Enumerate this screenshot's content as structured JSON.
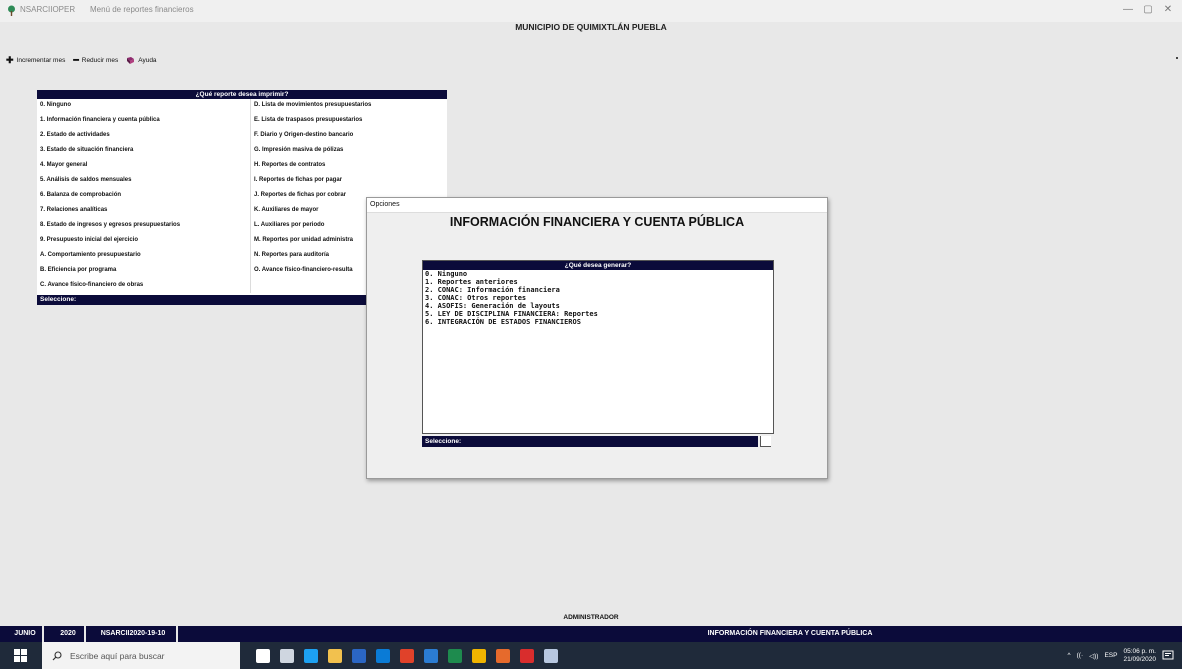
{
  "titlebar": {
    "app_name": "NSARCIIOPER",
    "window_title": "Menú de reportes financieros",
    "minimize_icon": "minimize-icon",
    "maximize_icon": "maximize-icon",
    "close_icon": "close-icon"
  },
  "municipio": "MUNICIPIO DE QUIMIXTLÁN PUEBLA",
  "toolbar": {
    "increment_label": "Incrementar mes",
    "reduce_label": "Reducir mes",
    "help_label": "Ayuda"
  },
  "report_menu": {
    "header": "¿Qué reporte desea imprimir?",
    "left_items": [
      "0. Ninguno",
      "1. Información financiera y cuenta pública",
      "2. Estado de actividades",
      "3. Estado de situación financiera",
      "4. Mayor general",
      "5. Análisis de saldos mensuales",
      "6. Balanza de comprobación",
      "7. Relaciones analíticas",
      "8. Estado de ingresos y egresos presupuestarios",
      "9. Presupuesto inicial del ejercicio",
      "A. Comportamiento presupuestario",
      "B. Eficiencia por programa",
      "C. Avance físico-financiero de obras"
    ],
    "right_items": [
      "D. Lista de movimientos presupuestarios",
      "E. Lista de traspasos presupuestarios",
      "F. Diario y Origen-destino bancario",
      "G. Impresión masiva de pólizas",
      "H. Reportes de contratos",
      "I. Reportes de fichas por pagar",
      "J. Reportes de fichas por cobrar",
      "K. Auxiliares de mayor",
      "L. Auxiliares por periodo",
      "M. Reportes por unidad administra",
      "N. Reportes para auditoría",
      "O. Avance físico-financiero-resulta"
    ],
    "footer": "Seleccione:"
  },
  "dialog": {
    "title": "Opciones",
    "heading": "INFORMACIÓN FINANCIERA Y CUENTA PÚBLICA",
    "box_header": "¿Qué desea generar?",
    "items": [
      "0. Ninguno",
      "1. Reportes anteriores",
      "2. CONAC: Información financiera",
      "3. CONAC: Otros reportes",
      "4. ASOFIS: Generación de layouts",
      "5. LEY DE DISCIPLINA FINANCIERA: Reportes",
      "6. INTEGRACIÓN DE ESTADOS FINANCIEROS"
    ],
    "footer": "Seleccione:",
    "input_value": ""
  },
  "status": {
    "user": "ADMINISTRADOR",
    "month": "JUNIO",
    "year": "2020",
    "system": "NSARCII2020-19-10",
    "current_module": "INFORMACIÓN FINANCIERA Y CUENTA PÚBLICA"
  },
  "taskbar": {
    "search_placeholder": "Escribe aquí para buscar",
    "language": "ESP",
    "time": "05:06 p. m.",
    "date": "21/09/2020",
    "app_colors": [
      "#ffffff",
      "#cfd6e0",
      "#1da1f2",
      "#f2c14e",
      "#2b66c4",
      "#0a7bd6",
      "#e0422a",
      "#2b7cd3",
      "#1e8b4e",
      "#f0b400",
      "#e66a2c",
      "#d92d2d",
      "#b7c7e0"
    ]
  },
  "colors": {
    "navy": "#0b0b3a",
    "background": "#e8e8e8",
    "taskbar": "#1f2a3a"
  }
}
